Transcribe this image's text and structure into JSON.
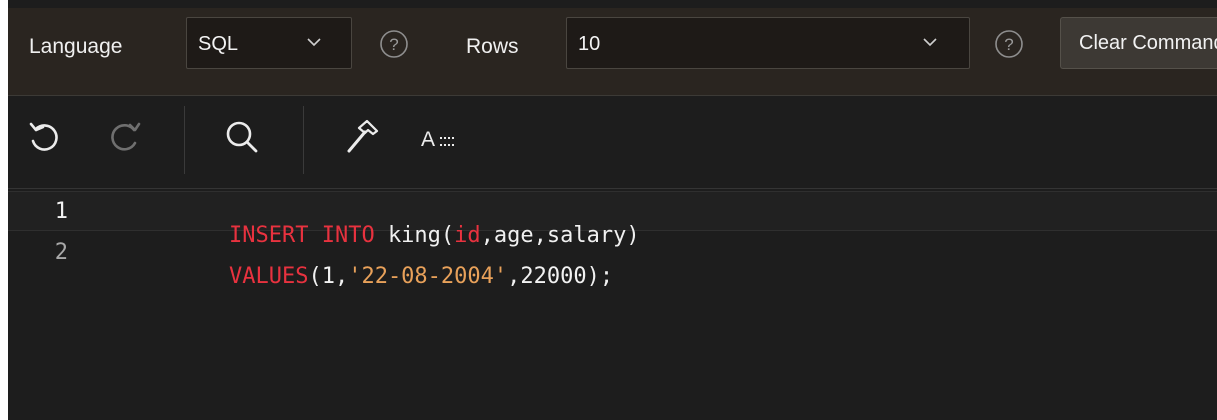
{
  "header": {
    "language_label": "Language",
    "language_value": "SQL",
    "rows_label": "Rows",
    "rows_value": "10",
    "help_glyph": "?",
    "clear_label": "Clear Command"
  },
  "toolbar": {
    "icons": [
      "undo-icon",
      "redo-icon",
      "search-icon",
      "hammer-icon",
      "font-size-icon"
    ],
    "font_size_label": "A"
  },
  "editor": {
    "lines": [
      {
        "number": "1",
        "tokens": [
          {
            "text": "INSERT",
            "type": "kw"
          },
          {
            "text": " ",
            "type": "punc"
          },
          {
            "text": "INTO",
            "type": "kw"
          },
          {
            "text": " ",
            "type": "punc"
          },
          {
            "text": "king",
            "type": "ident"
          },
          {
            "text": "(",
            "type": "punc"
          },
          {
            "text": "id",
            "type": "kw"
          },
          {
            "text": ",",
            "type": "punc"
          },
          {
            "text": "age",
            "type": "ident"
          },
          {
            "text": ",",
            "type": "punc"
          },
          {
            "text": "salary",
            "type": "ident"
          },
          {
            "text": ")",
            "type": "punc"
          }
        ]
      },
      {
        "number": "2",
        "tokens": [
          {
            "text": "VALUES",
            "type": "kw"
          },
          {
            "text": "(",
            "type": "punc"
          },
          {
            "text": "1",
            "type": "num"
          },
          {
            "text": ",",
            "type": "punc"
          },
          {
            "text": "'22-08-2004'",
            "type": "str"
          },
          {
            "text": ",",
            "type": "punc"
          },
          {
            "text": "22000",
            "type": "num"
          },
          {
            "text": ");",
            "type": "punc"
          }
        ]
      }
    ]
  },
  "colors": {
    "keyword": "#e8323f",
    "string": "#e8a15a",
    "text": "#f0f0f0",
    "background": "#1d1d1d",
    "header_background": "#2a2520",
    "gutter_active": "#f2f2f2",
    "gutter_inactive": "#a8a8a8"
  }
}
